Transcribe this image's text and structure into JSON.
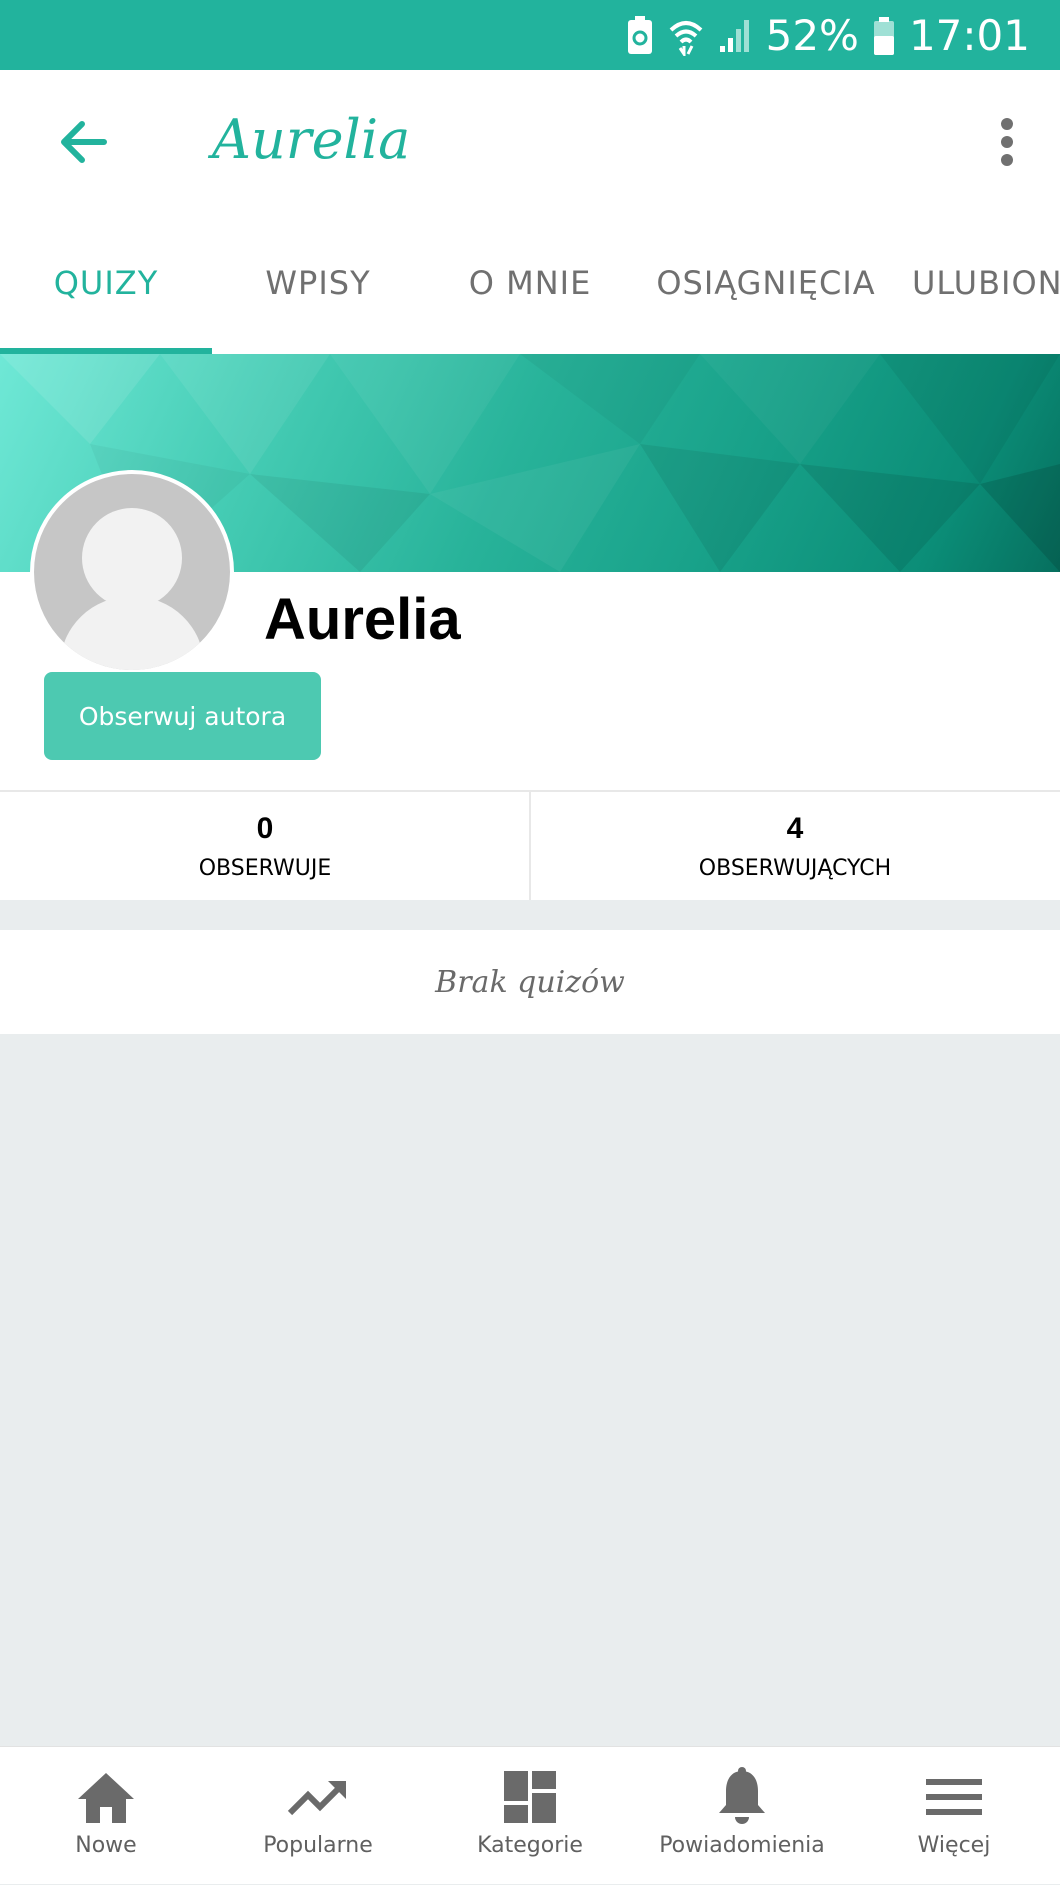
{
  "status_bar": {
    "battery": "52%",
    "time": "17:01"
  },
  "app_bar": {
    "title": "Aurelia"
  },
  "tabs": [
    {
      "label": "QUIZY",
      "active": true
    },
    {
      "label": "WPISY"
    },
    {
      "label": "O MNIE"
    },
    {
      "label": "OSIĄGNIĘCIA"
    },
    {
      "label": "ULUBION"
    }
  ],
  "profile": {
    "name": "Aurelia",
    "follow_label": "Obserwuj autora"
  },
  "stats": [
    {
      "value": "0",
      "label": "OBSERWUJE"
    },
    {
      "value": "4",
      "label": "OBSERWUJĄCYCH"
    }
  ],
  "empty_state": {
    "text": "Brak quizów"
  },
  "bottom_nav": [
    {
      "label": "Nowe",
      "icon": "home-icon"
    },
    {
      "label": "Popularne",
      "icon": "trending-icon"
    },
    {
      "label": "Kategorie",
      "icon": "dashboard-icon"
    },
    {
      "label": "Powiadomienia",
      "icon": "bell-icon"
    },
    {
      "label": "Więcej",
      "icon": "menu-icon"
    }
  ],
  "colors": {
    "accent": "#22b39d",
    "button": "#4dc9b1",
    "background": "#e9edee"
  }
}
